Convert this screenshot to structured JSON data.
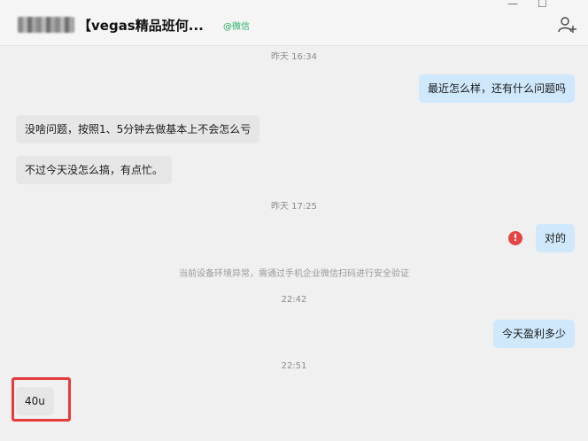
{
  "header": {
    "title": "【vegas精品班何...",
    "tag": "@微信",
    "window_controls": {
      "minimize": "—",
      "maximize": "☐"
    }
  },
  "messages": [
    {
      "kind": "time",
      "text": "昨天 16:34"
    },
    {
      "kind": "out",
      "text": "最近怎么样，还有什么问题吗"
    },
    {
      "kind": "in",
      "text": "没啥问题，按照1、5分钟去做基本上不会怎么亏"
    },
    {
      "kind": "in",
      "text": "不过今天没怎么搞，有点忙。"
    },
    {
      "kind": "time",
      "text": "昨天 17:25"
    },
    {
      "kind": "out",
      "text": "对的",
      "failed": true,
      "error_glyph": "!"
    },
    {
      "kind": "notice",
      "text": "当前设备环境异常，需通过手机企业微信扫码进行安全验证"
    },
    {
      "kind": "time",
      "text": "22:42"
    },
    {
      "kind": "out",
      "text": "今天盈利多少"
    },
    {
      "kind": "time",
      "text": "22:51"
    },
    {
      "kind": "in",
      "text": "40u",
      "highlighted": true
    }
  ],
  "colors": {
    "incoming_bubble": "#e6e6e6",
    "outgoing_bubble": "#cfe8fb",
    "error": "#e54545",
    "highlight_box": "#e53b3b",
    "tag": "#2aae67"
  }
}
